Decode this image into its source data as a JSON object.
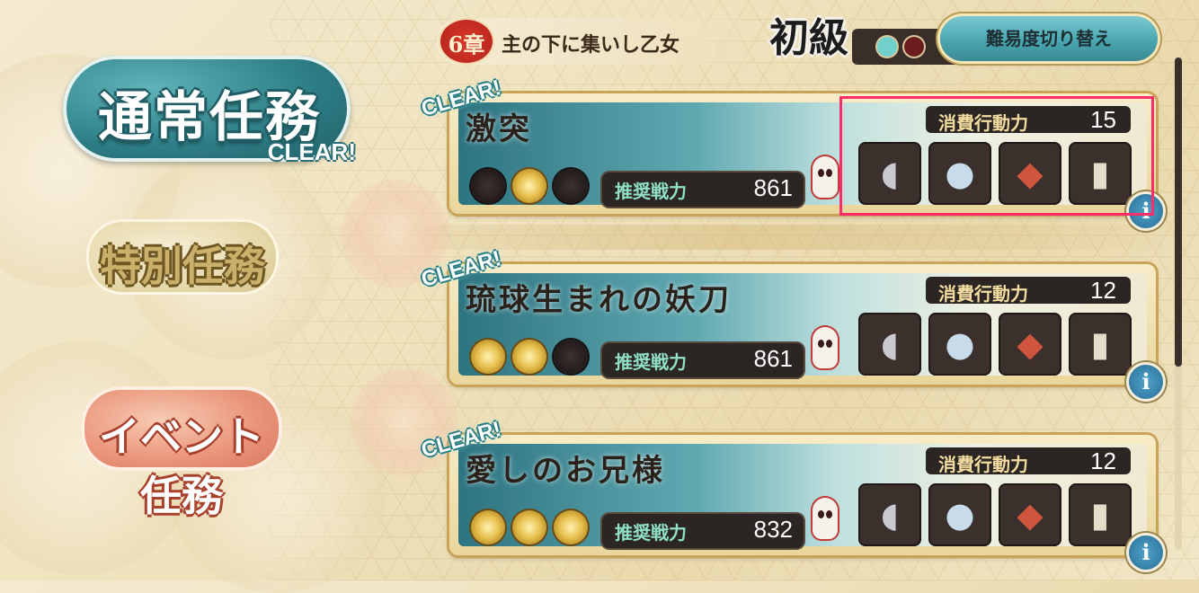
{
  "header": {
    "chapter_number": "6章",
    "chapter_title": "主の下に集いし乙女",
    "difficulty": "初級",
    "switch_button": "難易度切り替え"
  },
  "categories": [
    {
      "label": "通常任務",
      "status": "CLEAR!"
    },
    {
      "label": "特別任務"
    },
    {
      "label": "イベント任務"
    }
  ],
  "missions": [
    {
      "clear": "CLEAR!",
      "title": "激突",
      "stars": [
        false,
        true,
        false
      ],
      "power_label": "推奨戦力",
      "power": "861",
      "cost_label": "消費行動力",
      "cost": "15",
      "info": "i"
    },
    {
      "clear": "CLEAR!",
      "title": "琉球生まれの妖刀",
      "stars": [
        true,
        true,
        false
      ],
      "power_label": "推奨戦力",
      "power": "861",
      "cost_label": "消費行動力",
      "cost": "12",
      "info": "i"
    },
    {
      "clear": "CLEAR!",
      "title": "愛しのお兄様",
      "stars": [
        true,
        true,
        true
      ],
      "power_label": "推奨戦力",
      "power": "832",
      "cost_label": "消費行動力",
      "cost": "12",
      "info": "i"
    }
  ],
  "reward_items": [
    {
      "icon": "magatama-icon",
      "glyph": "◖"
    },
    {
      "icon": "crystal-orb-icon",
      "glyph": "●"
    },
    {
      "icon": "red-stone-icon",
      "glyph": "◆"
    },
    {
      "icon": "scroll-icon",
      "glyph": "▮"
    }
  ],
  "colors": {
    "accent_teal": "#3b8a94",
    "star_gold": "#e7c04f",
    "highlight": "#ff2e6a"
  },
  "scroll_position": 0.63
}
